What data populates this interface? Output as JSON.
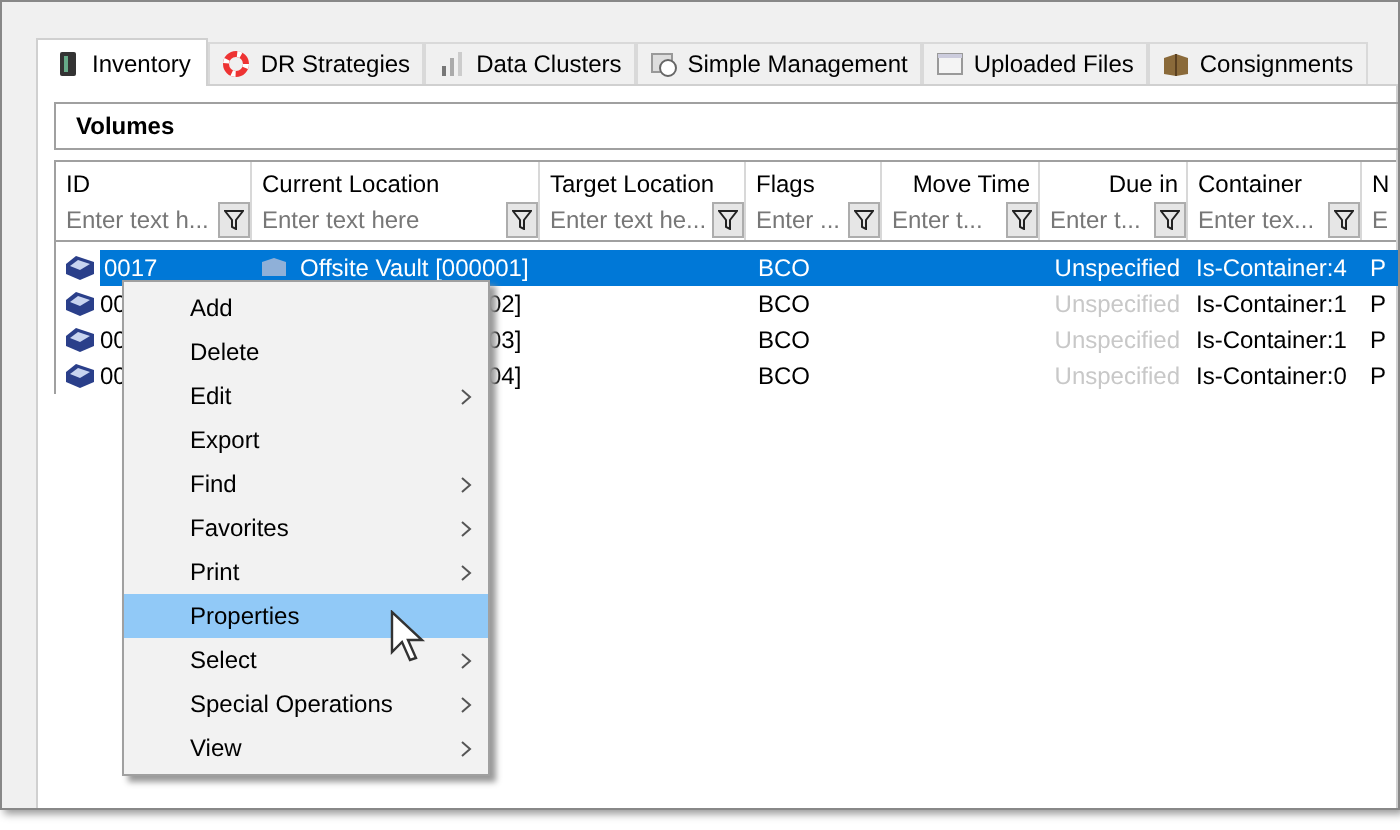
{
  "tabs": [
    {
      "label": "Inventory",
      "selected": true
    },
    {
      "label": "DR Strategies",
      "selected": false
    },
    {
      "label": "Data Clusters",
      "selected": false
    },
    {
      "label": "Simple Management",
      "selected": false
    },
    {
      "label": "Uploaded Files",
      "selected": false
    },
    {
      "label": "Consignments",
      "selected": false
    }
  ],
  "panel": {
    "title": "Volumes"
  },
  "table": {
    "columns": [
      {
        "label": "ID",
        "placeholder": "Enter text h..."
      },
      {
        "label": "Current Location",
        "placeholder": "Enter text here"
      },
      {
        "label": "Target Location",
        "placeholder": "Enter text he..."
      },
      {
        "label": "Flags",
        "placeholder": "Enter ..."
      },
      {
        "label": "Move Time",
        "placeholder": "Enter t..."
      },
      {
        "label": "Due in",
        "placeholder": "Enter t..."
      },
      {
        "label": "Container",
        "placeholder": "Enter tex..."
      },
      {
        "label": "N",
        "placeholder": "E"
      }
    ],
    "rows": [
      {
        "selected": true,
        "id": "0017",
        "current_location": "Offsite Vault [000001]",
        "flags": "BCO",
        "due_in": "Unspecified",
        "container": "Is-Container:4",
        "column_8": "P"
      },
      {
        "selected": false,
        "id": "00",
        "current_location": "02]",
        "flags": "BCO",
        "due_in": "Unspecified",
        "container": "Is-Container:1",
        "column_8": "P"
      },
      {
        "selected": false,
        "id": "00",
        "current_location": "03]",
        "flags": "BCO",
        "due_in": "Unspecified",
        "container": "Is-Container:1",
        "column_8": "P"
      },
      {
        "selected": false,
        "id": "00",
        "current_location": "04]",
        "flags": "BCO",
        "due_in": "Unspecified",
        "container": "Is-Container:0",
        "column_8": "P"
      }
    ]
  },
  "context_menu": {
    "items": [
      {
        "label": "Add",
        "submenu": false,
        "selected": false
      },
      {
        "label": "Delete",
        "submenu": false,
        "selected": false
      },
      {
        "label": "Edit",
        "submenu": true,
        "selected": false
      },
      {
        "label": "Export",
        "submenu": false,
        "selected": false
      },
      {
        "label": "Find",
        "submenu": true,
        "selected": false
      },
      {
        "label": "Favorites",
        "submenu": true,
        "selected": false
      },
      {
        "label": "Print",
        "submenu": true,
        "selected": false
      },
      {
        "label": "Properties",
        "submenu": false,
        "selected": true
      },
      {
        "label": "Select",
        "submenu": true,
        "selected": false
      },
      {
        "label": "Special Operations",
        "submenu": true,
        "selected": false
      },
      {
        "label": "View",
        "submenu": true,
        "selected": false
      }
    ]
  }
}
